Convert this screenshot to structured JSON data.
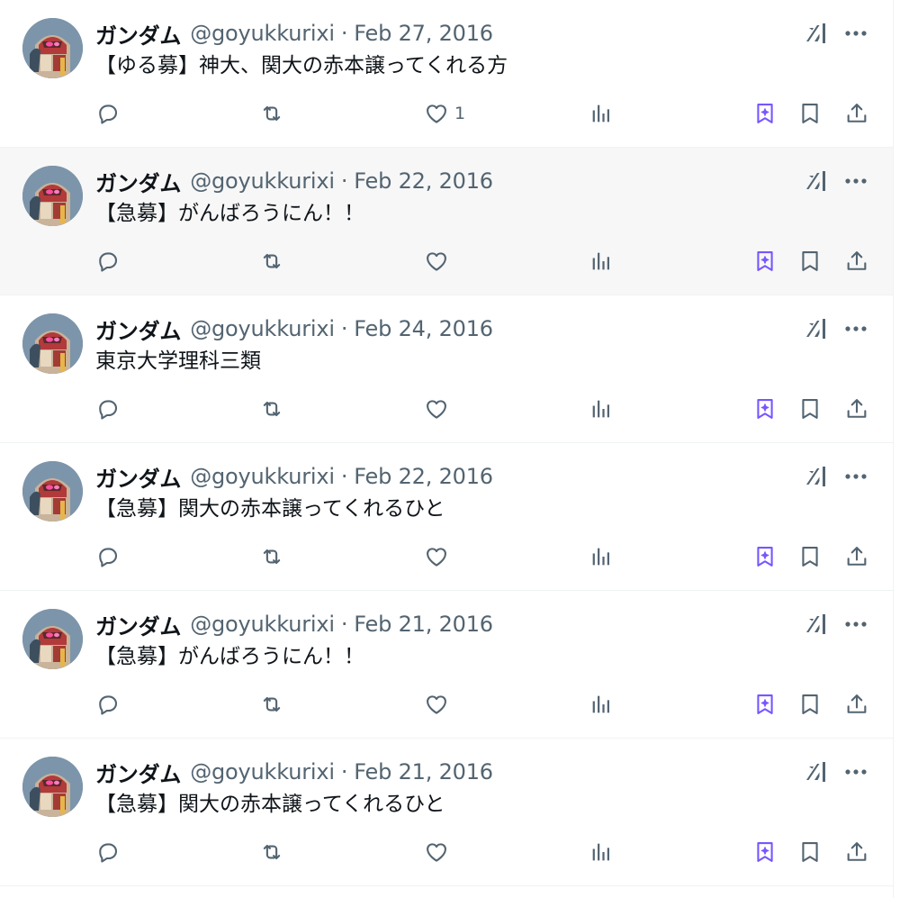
{
  "tweets": [
    {
      "name": "ガンダム",
      "handle": "@goyukkurixi",
      "dot": "·",
      "date": "Feb 27, 2016",
      "text": "【ゆる募】神大、関大の赤本譲ってくれる方",
      "likes": "1",
      "hover": false
    },
    {
      "name": "ガンダム",
      "handle": "@goyukkurixi",
      "dot": "·",
      "date": "Feb 22, 2016",
      "text": "【急募】がんばろうにん！！",
      "likes": "",
      "hover": true
    },
    {
      "name": "ガンダム",
      "handle": "@goyukkurixi",
      "dot": "·",
      "date": "Feb 24, 2016",
      "text": "東京大学理科三類",
      "likes": "",
      "hover": false
    },
    {
      "name": "ガンダム",
      "handle": "@goyukkurixi",
      "dot": "·",
      "date": "Feb 22, 2016",
      "text": "【急募】関大の赤本譲ってくれるひと",
      "likes": "",
      "hover": false
    },
    {
      "name": "ガンダム",
      "handle": "@goyukkurixi",
      "dot": "·",
      "date": "Feb 21, 2016",
      "text": "【急募】がんばろうにん！！",
      "likes": "",
      "hover": false
    },
    {
      "name": "ガンダム",
      "handle": "@goyukkurixi",
      "dot": "·",
      "date": "Feb 21, 2016",
      "text": "【急募】関大の赤本譲ってくれるひと",
      "likes": "",
      "hover": false
    }
  ],
  "colors": {
    "icon_gray": "#536471",
    "grok_purple": "#7856ff",
    "hover_bg": "#f7f7f7"
  }
}
